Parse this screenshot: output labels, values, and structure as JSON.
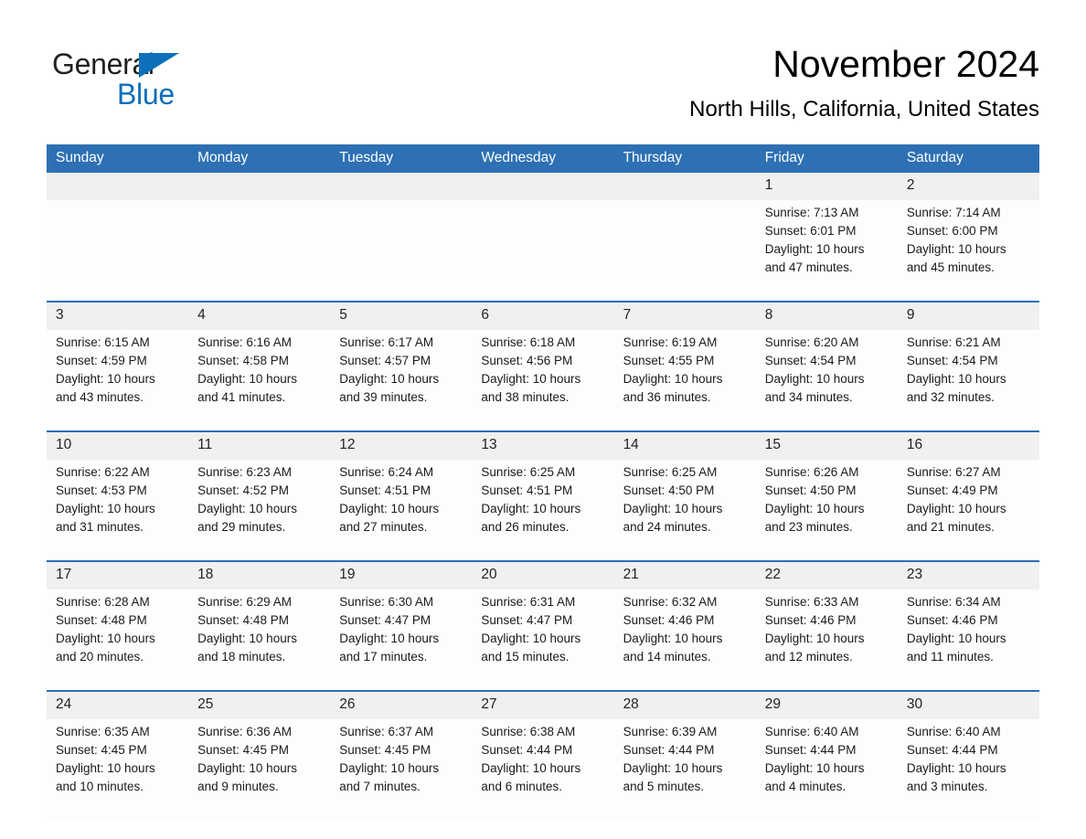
{
  "logo": {
    "word1": "General",
    "word2": "Blue",
    "triangle_color": "#0B6FBA"
  },
  "header": {
    "title": "November 2024",
    "subtitle": "North Hills, California, United States"
  },
  "theme": {
    "header_blue": "#2D70B3",
    "row_divider_blue": "#2D70B3",
    "day_band_gray": "#F0F0F0",
    "cell_background": "#FDFDFD"
  },
  "weekday_headers": [
    "Sunday",
    "Monday",
    "Tuesday",
    "Wednesday",
    "Thursday",
    "Friday",
    "Saturday"
  ],
  "weeks": [
    [
      {
        "day": "",
        "sunrise": "",
        "sunset": "",
        "daylight1": "",
        "daylight2": ""
      },
      {
        "day": "",
        "sunrise": "",
        "sunset": "",
        "daylight1": "",
        "daylight2": ""
      },
      {
        "day": "",
        "sunrise": "",
        "sunset": "",
        "daylight1": "",
        "daylight2": ""
      },
      {
        "day": "",
        "sunrise": "",
        "sunset": "",
        "daylight1": "",
        "daylight2": ""
      },
      {
        "day": "",
        "sunrise": "",
        "sunset": "",
        "daylight1": "",
        "daylight2": ""
      },
      {
        "day": "1",
        "sunrise": "Sunrise: 7:13 AM",
        "sunset": "Sunset: 6:01 PM",
        "daylight1": "Daylight: 10 hours",
        "daylight2": "and 47 minutes."
      },
      {
        "day": "2",
        "sunrise": "Sunrise: 7:14 AM",
        "sunset": "Sunset: 6:00 PM",
        "daylight1": "Daylight: 10 hours",
        "daylight2": "and 45 minutes."
      }
    ],
    [
      {
        "day": "3",
        "sunrise": "Sunrise: 6:15 AM",
        "sunset": "Sunset: 4:59 PM",
        "daylight1": "Daylight: 10 hours",
        "daylight2": "and 43 minutes."
      },
      {
        "day": "4",
        "sunrise": "Sunrise: 6:16 AM",
        "sunset": "Sunset: 4:58 PM",
        "daylight1": "Daylight: 10 hours",
        "daylight2": "and 41 minutes."
      },
      {
        "day": "5",
        "sunrise": "Sunrise: 6:17 AM",
        "sunset": "Sunset: 4:57 PM",
        "daylight1": "Daylight: 10 hours",
        "daylight2": "and 39 minutes."
      },
      {
        "day": "6",
        "sunrise": "Sunrise: 6:18 AM",
        "sunset": "Sunset: 4:56 PM",
        "daylight1": "Daylight: 10 hours",
        "daylight2": "and 38 minutes."
      },
      {
        "day": "7",
        "sunrise": "Sunrise: 6:19 AM",
        "sunset": "Sunset: 4:55 PM",
        "daylight1": "Daylight: 10 hours",
        "daylight2": "and 36 minutes."
      },
      {
        "day": "8",
        "sunrise": "Sunrise: 6:20 AM",
        "sunset": "Sunset: 4:54 PM",
        "daylight1": "Daylight: 10 hours",
        "daylight2": "and 34 minutes."
      },
      {
        "day": "9",
        "sunrise": "Sunrise: 6:21 AM",
        "sunset": "Sunset: 4:54 PM",
        "daylight1": "Daylight: 10 hours",
        "daylight2": "and 32 minutes."
      }
    ],
    [
      {
        "day": "10",
        "sunrise": "Sunrise: 6:22 AM",
        "sunset": "Sunset: 4:53 PM",
        "daylight1": "Daylight: 10 hours",
        "daylight2": "and 31 minutes."
      },
      {
        "day": "11",
        "sunrise": "Sunrise: 6:23 AM",
        "sunset": "Sunset: 4:52 PM",
        "daylight1": "Daylight: 10 hours",
        "daylight2": "and 29 minutes."
      },
      {
        "day": "12",
        "sunrise": "Sunrise: 6:24 AM",
        "sunset": "Sunset: 4:51 PM",
        "daylight1": "Daylight: 10 hours",
        "daylight2": "and 27 minutes."
      },
      {
        "day": "13",
        "sunrise": "Sunrise: 6:25 AM",
        "sunset": "Sunset: 4:51 PM",
        "daylight1": "Daylight: 10 hours",
        "daylight2": "and 26 minutes."
      },
      {
        "day": "14",
        "sunrise": "Sunrise: 6:25 AM",
        "sunset": "Sunset: 4:50 PM",
        "daylight1": "Daylight: 10 hours",
        "daylight2": "and 24 minutes."
      },
      {
        "day": "15",
        "sunrise": "Sunrise: 6:26 AM",
        "sunset": "Sunset: 4:50 PM",
        "daylight1": "Daylight: 10 hours",
        "daylight2": "and 23 minutes."
      },
      {
        "day": "16",
        "sunrise": "Sunrise: 6:27 AM",
        "sunset": "Sunset: 4:49 PM",
        "daylight1": "Daylight: 10 hours",
        "daylight2": "and 21 minutes."
      }
    ],
    [
      {
        "day": "17",
        "sunrise": "Sunrise: 6:28 AM",
        "sunset": "Sunset: 4:48 PM",
        "daylight1": "Daylight: 10 hours",
        "daylight2": "and 20 minutes."
      },
      {
        "day": "18",
        "sunrise": "Sunrise: 6:29 AM",
        "sunset": "Sunset: 4:48 PM",
        "daylight1": "Daylight: 10 hours",
        "daylight2": "and 18 minutes."
      },
      {
        "day": "19",
        "sunrise": "Sunrise: 6:30 AM",
        "sunset": "Sunset: 4:47 PM",
        "daylight1": "Daylight: 10 hours",
        "daylight2": "and 17 minutes."
      },
      {
        "day": "20",
        "sunrise": "Sunrise: 6:31 AM",
        "sunset": "Sunset: 4:47 PM",
        "daylight1": "Daylight: 10 hours",
        "daylight2": "and 15 minutes."
      },
      {
        "day": "21",
        "sunrise": "Sunrise: 6:32 AM",
        "sunset": "Sunset: 4:46 PM",
        "daylight1": "Daylight: 10 hours",
        "daylight2": "and 14 minutes."
      },
      {
        "day": "22",
        "sunrise": "Sunrise: 6:33 AM",
        "sunset": "Sunset: 4:46 PM",
        "daylight1": "Daylight: 10 hours",
        "daylight2": "and 12 minutes."
      },
      {
        "day": "23",
        "sunrise": "Sunrise: 6:34 AM",
        "sunset": "Sunset: 4:46 PM",
        "daylight1": "Daylight: 10 hours",
        "daylight2": "and 11 minutes."
      }
    ],
    [
      {
        "day": "24",
        "sunrise": "Sunrise: 6:35 AM",
        "sunset": "Sunset: 4:45 PM",
        "daylight1": "Daylight: 10 hours",
        "daylight2": "and 10 minutes."
      },
      {
        "day": "25",
        "sunrise": "Sunrise: 6:36 AM",
        "sunset": "Sunset: 4:45 PM",
        "daylight1": "Daylight: 10 hours",
        "daylight2": "and 9 minutes."
      },
      {
        "day": "26",
        "sunrise": "Sunrise: 6:37 AM",
        "sunset": "Sunset: 4:45 PM",
        "daylight1": "Daylight: 10 hours",
        "daylight2": "and 7 minutes."
      },
      {
        "day": "27",
        "sunrise": "Sunrise: 6:38 AM",
        "sunset": "Sunset: 4:44 PM",
        "daylight1": "Daylight: 10 hours",
        "daylight2": "and 6 minutes."
      },
      {
        "day": "28",
        "sunrise": "Sunrise: 6:39 AM",
        "sunset": "Sunset: 4:44 PM",
        "daylight1": "Daylight: 10 hours",
        "daylight2": "and 5 minutes."
      },
      {
        "day": "29",
        "sunrise": "Sunrise: 6:40 AM",
        "sunset": "Sunset: 4:44 PM",
        "daylight1": "Daylight: 10 hours",
        "daylight2": "and 4 minutes."
      },
      {
        "day": "30",
        "sunrise": "Sunrise: 6:40 AM",
        "sunset": "Sunset: 4:44 PM",
        "daylight1": "Daylight: 10 hours",
        "daylight2": "and 3 minutes."
      }
    ]
  ]
}
